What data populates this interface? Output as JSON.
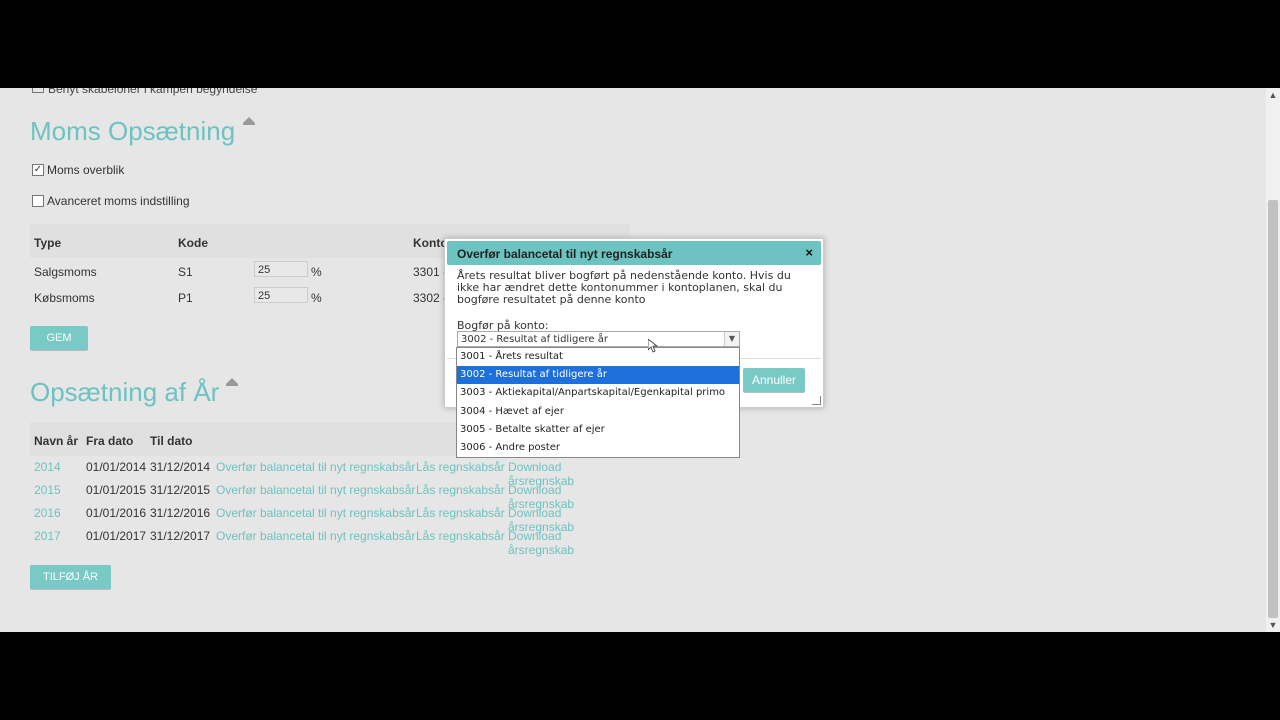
{
  "cut_line_text": "Benyt skabeloner i kampen begyndelse",
  "moms": {
    "title": "Moms Opsætning",
    "check_overblik": "Moms overblik",
    "check_avanceret": "Avanceret moms indstilling",
    "headers": {
      "type": "Type",
      "kode": "Kode",
      "konto": "Konto"
    },
    "rows": [
      {
        "type": "Salgsmoms",
        "kode": "S1",
        "pct": "25",
        "unit": "%",
        "konto": "3301 -"
      },
      {
        "type": "Købsmoms",
        "kode": "P1",
        "pct": "25",
        "unit": "%",
        "konto": "3302 -"
      }
    ],
    "save_label": "GEM"
  },
  "years": {
    "title": "Opsætning af År",
    "headers": {
      "navn": "Navn år",
      "fra": "Fra dato",
      "til": "Til dato"
    },
    "rows": [
      {
        "year": "2014",
        "from": "01/01/2014",
        "to": "31/12/2014"
      },
      {
        "year": "2015",
        "from": "01/01/2015",
        "to": "31/12/2015"
      },
      {
        "year": "2016",
        "from": "01/01/2016",
        "to": "31/12/2016"
      },
      {
        "year": "2017",
        "from": "01/01/2017",
        "to": "31/12/2017"
      }
    ],
    "link_transfer": "Overfør balancetal til nyt regnskabsår",
    "link_lock": "Lås regnskabsår",
    "link_download": "Download årsregnskab",
    "add_label": "TILFØJ ÅR"
  },
  "modal": {
    "title": "Overfør balancetal til nyt regnskabsår",
    "close": "×",
    "body_lines": [
      "Årets resultat bliver bogført på nedenstående konto. Hvis du",
      "ikke har ændret dette kontonummer i kontoplanen, skal du",
      "bogføre resultatet på denne konto"
    ],
    "label": "Bogfør på konto:",
    "selected": "3002 - Resultat af tidligere år",
    "cancel_label": "Annuller",
    "options": [
      "3001 - Årets resultat",
      "3002 - Resultat af tidligere år",
      "3003 - Aktiekapital/Anpartskapital/Egenkapital primo",
      "3004 - Hævet af ejer",
      "3005 - Betalte skatter af ejer",
      "3006 - Andre poster"
    ],
    "selected_index": 1
  },
  "colors": {
    "accent": "#6cc3c1",
    "button": "#79c9c6",
    "highlight": "#1e6fd9"
  },
  "icons": {
    "collapse": "collapse-up-icon",
    "close": "close-icon",
    "dropdown": "chevron-down-icon"
  }
}
